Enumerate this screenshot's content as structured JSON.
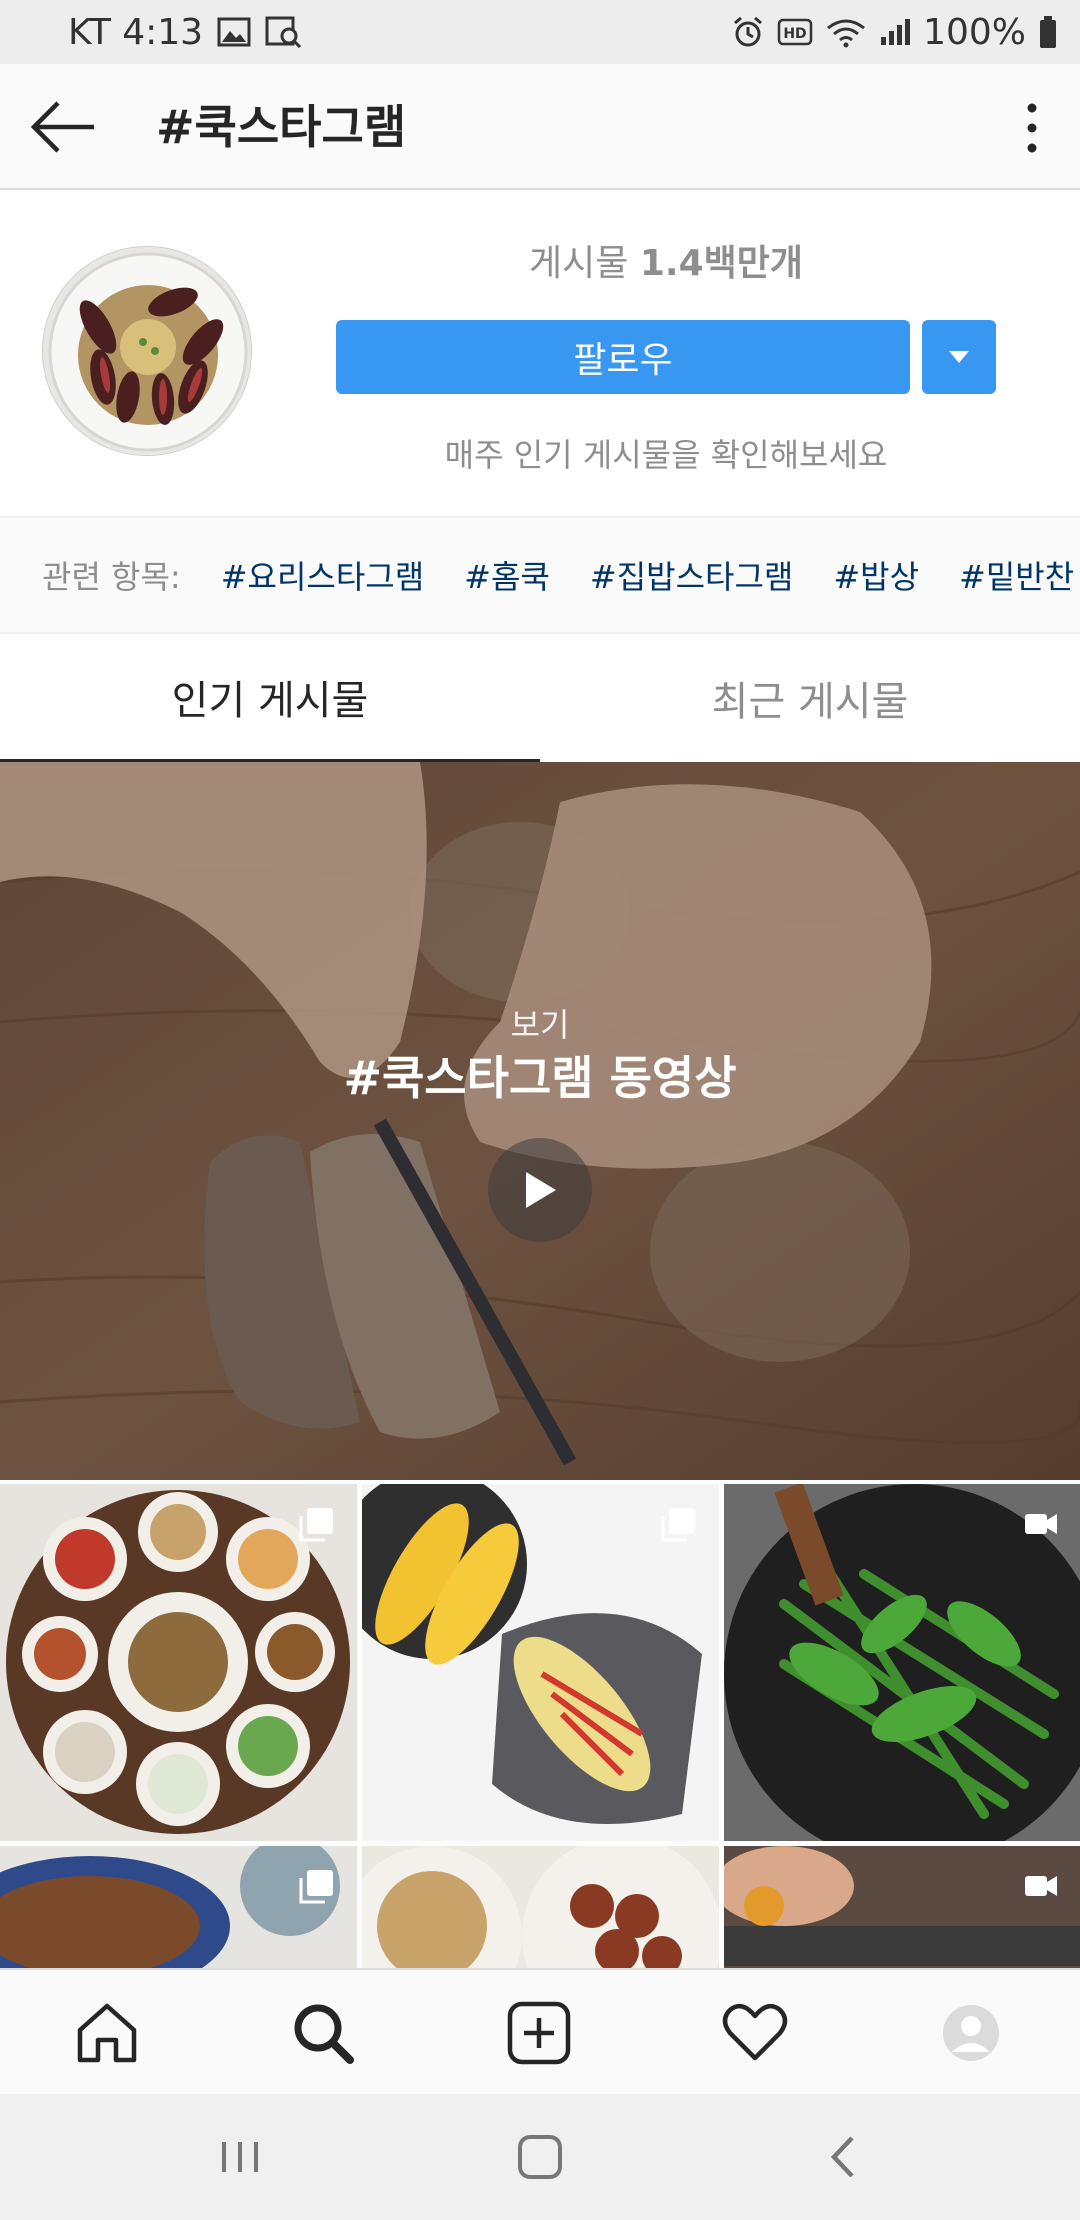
{
  "status_bar": {
    "carrier_time": "KT 4:13",
    "battery": "100%",
    "icons_left": [
      "gallery-icon",
      "screenshot-search-icon"
    ],
    "icons_right": [
      "alarm-icon",
      "hd-icon",
      "wifi-icon",
      "signal-icon",
      "battery-icon"
    ]
  },
  "header": {
    "title": "#쿡스타그램",
    "back_icon": "back-arrow-icon",
    "more_icon": "more-vertical-icon"
  },
  "profile": {
    "posts_label": "게시물",
    "posts_count": "1.4백만개",
    "follow_label": "팔로우",
    "weekly_text": "매주 인기 게시물을 확인해보세요"
  },
  "related": {
    "label": "관련 항목:",
    "tags": [
      "#요리스타그램",
      "#홈쿡",
      "#집밥스타그램",
      "#밥상",
      "#밑반찬"
    ]
  },
  "tabs": [
    {
      "label": "인기 게시물",
      "active": true
    },
    {
      "label": "최근 게시물",
      "active": false
    }
  ],
  "video": {
    "subtitle": "보기",
    "title": "#쿡스타그램 동영상"
  },
  "grid": {
    "items": [
      {
        "type": "multi"
      },
      {
        "type": "multi"
      },
      {
        "type": "video"
      },
      {
        "type": "multi"
      },
      {
        "type": "none"
      },
      {
        "type": "video"
      }
    ]
  },
  "bottom_nav": [
    "home-icon",
    "search-icon",
    "add-post-icon",
    "heart-icon",
    "profile-avatar"
  ],
  "colors": {
    "accent": "#3897f0",
    "tag_link": "#003569",
    "muted": "#8e8e8e"
  }
}
